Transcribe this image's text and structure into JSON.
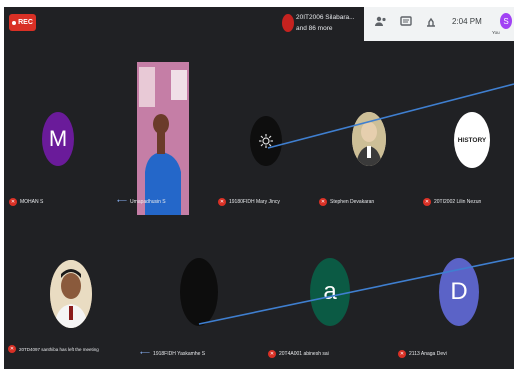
{
  "topbar": {
    "rec_label": "REC",
    "notification": {
      "line1": "20IT2006 Silabara...",
      "line2": "and 86 more"
    },
    "time": "2:04 PM",
    "you_label": "You",
    "user_initial": "S",
    "icons": [
      "people-icon",
      "chat-icon",
      "activities-icon"
    ]
  },
  "tiles": [
    {
      "initial": "M",
      "name": "MOHAN S",
      "avatar_color": "#6a1b9a"
    },
    {
      "name": "Umapadhusin S",
      "pinned": true
    },
    {
      "name": "19180FIDH Mary Jincy",
      "avatar": "gear-icon"
    },
    {
      "name": "Stephen Devakaran"
    },
    {
      "name": "20TI2002 Lilin Nezun",
      "logo_text": "HISTORY"
    },
    {
      "name": "20TD4097 santhiba has left the meeting"
    },
    {
      "name": "1918FIDH Yaskamhe S",
      "pinned": true
    },
    {
      "initial": "a",
      "name": "20T4A001 abinesh sai",
      "avatar_color": "#0b5a44"
    },
    {
      "initial": "D",
      "name": "2113 Anaga Devi",
      "avatar_color": "#5b63c7"
    }
  ],
  "colors": {
    "meet_dark": "#202124",
    "rec_red": "#d93025",
    "annotation_line": "#3f7fd0"
  }
}
